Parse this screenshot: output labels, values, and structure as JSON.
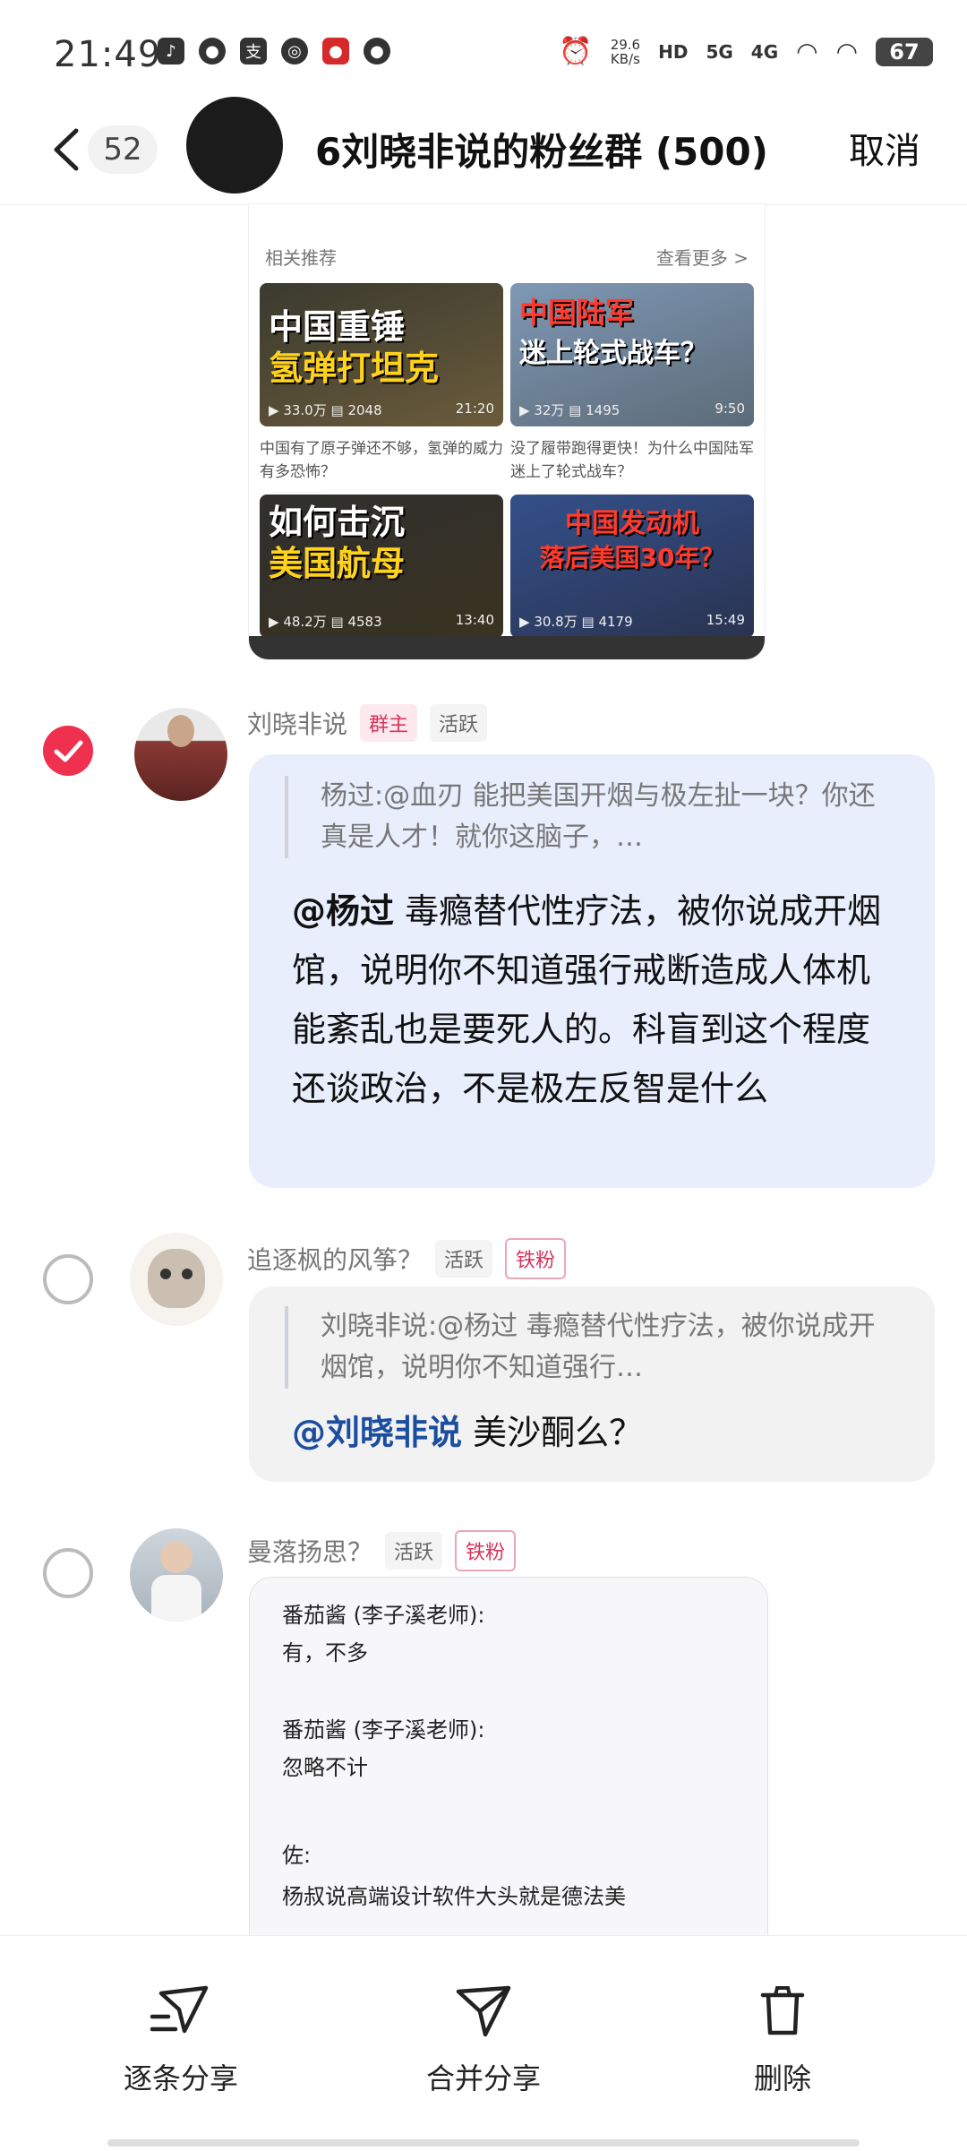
{
  "status_bar": {
    "time": "21:49",
    "net_speed_value": "29.6",
    "net_speed_unit": "KB/s",
    "hd": "HD",
    "sig1": "5G",
    "sig2": "4G",
    "battery": "67"
  },
  "header": {
    "unread_count": "52",
    "title": "6刘晓非说的粉丝群 (500)",
    "cancel_label": "取消"
  },
  "shared_card": {
    "section_label": "相关推荐",
    "more_label": "查看更多 >",
    "videos": [
      {
        "thumb_line1": "中国重锤",
        "thumb_line2": "氢弹打坦克",
        "views": "33.0万",
        "comments": "2048",
        "duration": "21:20",
        "caption": "中国有了原子弹还不够，氢弹的威力有多恐怖？"
      },
      {
        "thumb_line1": "中国陆军",
        "thumb_line2": "迷上轮式战车？",
        "views": "32万",
        "comments": "1495",
        "duration": "9:50",
        "caption": "没了履带跑得更快！为什么中国陆军迷上了轮式战车？"
      },
      {
        "thumb_line1": "如何击沉",
        "thumb_line2": "美国航母",
        "views": "48.2万",
        "comments": "4583",
        "duration": "13:40",
        "caption": ""
      },
      {
        "thumb_line1": "中国发动机",
        "thumb_line2": "落后美国30年？",
        "views": "30.8万",
        "comments": "4179",
        "duration": "15:49",
        "caption": ""
      }
    ]
  },
  "messages": [
    {
      "sender": "刘晓非说",
      "tags": [
        "群主",
        "活跃"
      ],
      "quote": "杨过:@血刃 能把美国开烟与极左扯一块？你还真是人才！就你这脑子，…",
      "mention": "@杨过",
      "text": " 毒瘾替代性疗法，被你说成开烟馆，说明你不知道强行戒断造成人体机能紊乱也是要死人的。科盲到这个程度还谈政治，不是极左反智是什么",
      "selected": true
    },
    {
      "sender": "追逐枫的风筝？",
      "tags": [
        "活跃",
        "铁粉"
      ],
      "quote": "刘晓非说:@杨过 毒瘾替代性疗法，被你说成开烟馆，说明你不知道强行…",
      "mention": "@刘晓非说",
      "text": " 美沙酮么？",
      "selected": false
    },
    {
      "sender": "曼落扬思？",
      "tags": [
        "活跃",
        "铁粉"
      ],
      "image_lines": [
        "番茄酱 (李子溪老师):",
        "有，不多",
        "番茄酱 (李子溪老师):",
        "忽略不计",
        "佐:",
        "杨叔说高端设计软件大头就是德法美"
      ],
      "selected": false
    }
  ],
  "actions": [
    {
      "label": "逐条分享",
      "icon": "share-each-icon"
    },
    {
      "label": "合并分享",
      "icon": "share-merge-icon"
    },
    {
      "label": "删除",
      "icon": "trash-icon"
    }
  ],
  "colors": {
    "accent": "#f0304f",
    "bubble_blue": "#e8eefc",
    "mention_blue": "#1c4ea0"
  }
}
